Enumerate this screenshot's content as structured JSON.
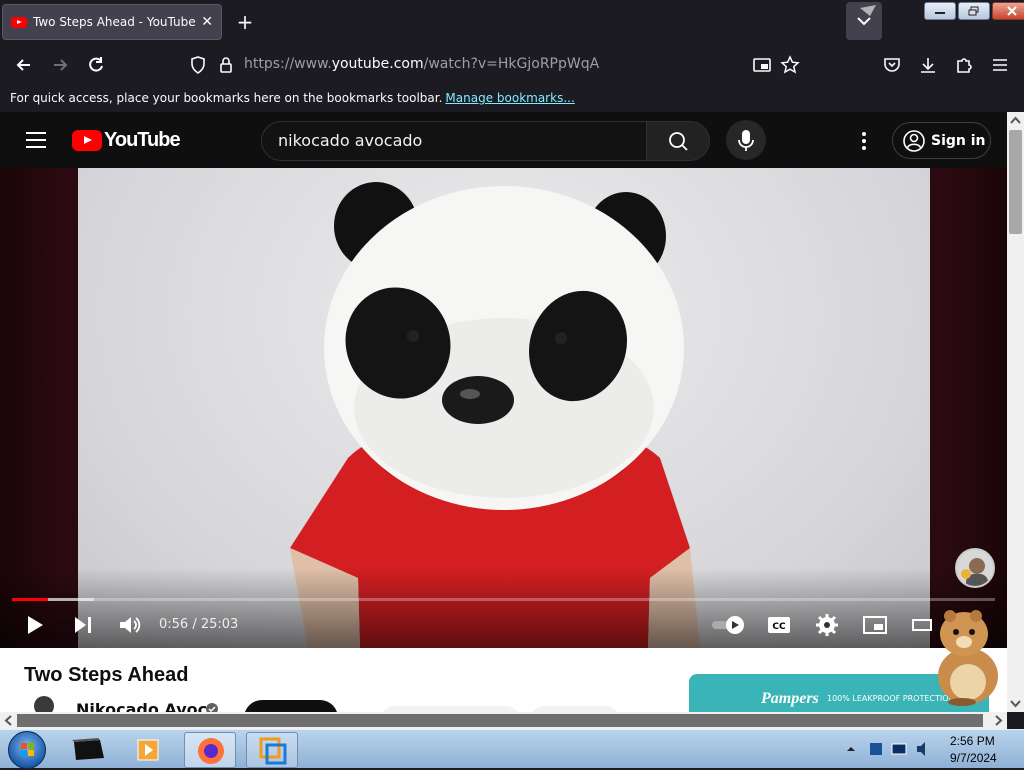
{
  "browser": {
    "tab_title": "Two Steps Ahead - YouTube",
    "new_tab": "+",
    "url_prefix": "https://www.",
    "url_domain": "youtube.com",
    "url_path": "/watch?v=HkGjoRPpWqA",
    "bookmarks_message": "For quick access, place your bookmarks here on the bookmarks toolbar.",
    "manage_bookmarks": "Manage bookmarks..."
  },
  "youtube": {
    "logo_text": "YouTube",
    "search_value": "nikocado avocado",
    "sign_in": "Sign in",
    "player": {
      "time": "0:56 / 25:03",
      "played_fraction": 0.037,
      "buffered_fraction": 0.083
    },
    "video_title": "Two Steps Ahead",
    "channel_name": "Nikocado Avoc",
    "ad_text": "Pampers",
    "ad_tag": "100% LEAKPROOF PROTECTION"
  },
  "taskbar": {
    "time": "2:56 PM",
    "date": "9/7/2024"
  },
  "colors": {
    "youtube_red": "#ff0000",
    "browser_bg": "#1c1b22",
    "link": "#80ebff"
  }
}
